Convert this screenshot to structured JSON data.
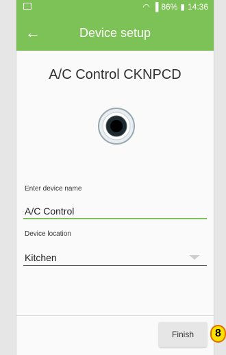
{
  "status_bar": {
    "battery": "86%",
    "time": "14:36"
  },
  "app_bar": {
    "title": "Device setup"
  },
  "device": {
    "name": "A/C Control CKNPCD"
  },
  "form": {
    "name_label": "Enter device name",
    "name_value": "A/C Control",
    "location_label": "Device location",
    "location_value": "Kitchen"
  },
  "actions": {
    "finish_label": "Finish"
  },
  "annotation": {
    "marker": "8"
  },
  "colors": {
    "accent": "#7dc256",
    "badge": "#ffe000"
  }
}
